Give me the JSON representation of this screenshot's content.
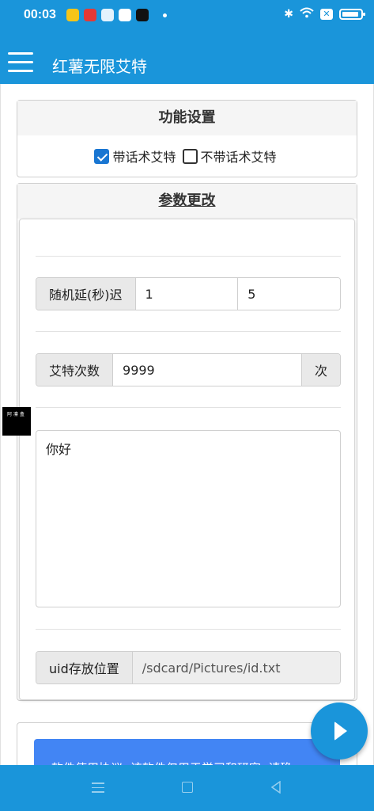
{
  "status_bar": {
    "time": "00:03",
    "app_icons": [
      "weibo-icon",
      "news-icon",
      "app-icon",
      "browser-icon",
      "tiktok-icon"
    ],
    "indicators": [
      "bluetooth-icon",
      "wifi-icon",
      "sim-x-icon",
      "battery-icon"
    ]
  },
  "app_bar": {
    "title": "红薯无限艾特"
  },
  "function_settings": {
    "title": "功能设置",
    "options": [
      {
        "label": "带话术艾特",
        "checked": true
      },
      {
        "label": "不带话术艾特",
        "checked": false
      }
    ]
  },
  "params": {
    "title": "参数更改",
    "delay": {
      "label": "随机延(秒)迟",
      "min": "1",
      "max": "5"
    },
    "count": {
      "label": "艾特次数",
      "value": "9999",
      "suffix": "次"
    },
    "message": "你好",
    "uid_path": {
      "label": "uid存放位置",
      "value": "/sdcard/Pictures/id.txt"
    }
  },
  "notice": {
    "text": "软件使用协议: 该软件仅用于学习和研究, 请确"
  },
  "floating_badge": "阿 凛 盒",
  "colors": {
    "primary": "#1a95da",
    "notice_bg": "#4285f4",
    "checkbox_on": "#1976d2"
  }
}
